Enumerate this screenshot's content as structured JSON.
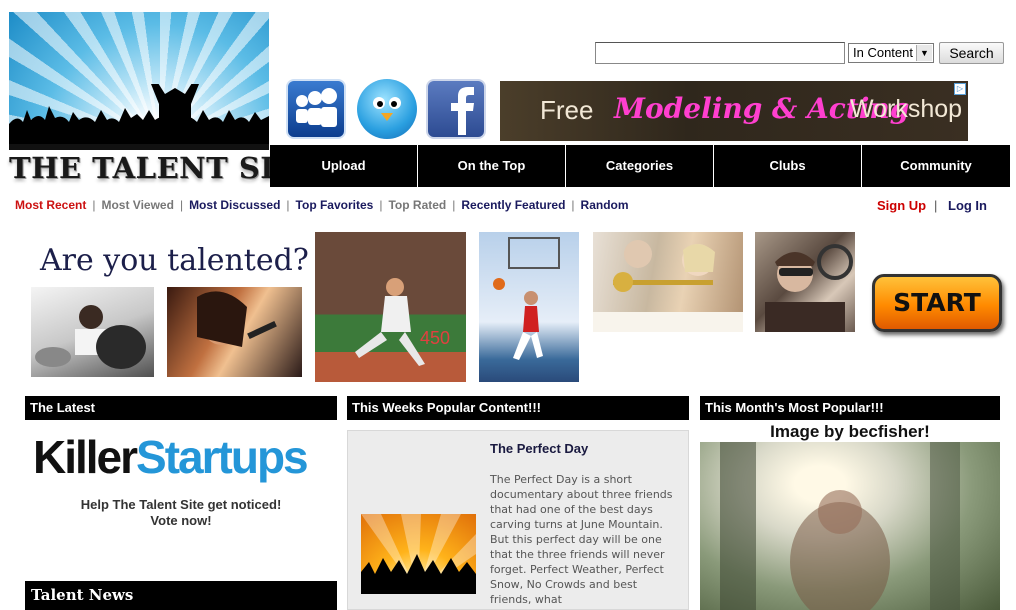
{
  "site": {
    "name": "THE TALENT SITE"
  },
  "search": {
    "placeholder": "",
    "scope": "In Content",
    "button": "Search"
  },
  "social": [
    {
      "icon": "myspace-icon"
    },
    {
      "icon": "twitter-icon"
    },
    {
      "icon": "facebook-icon"
    }
  ],
  "ad": {
    "free": "Free",
    "main": "Modeling & Acting",
    "tail": "Workshop",
    "badge": "▷"
  },
  "nav": [
    "Upload",
    "On the Top",
    "Categories",
    "Clubs",
    "Community"
  ],
  "subnav": [
    "Most Recent",
    "Most Viewed",
    "Most Discussed",
    "Top Favorites",
    "Top Rated",
    "Recently Featured",
    "Random"
  ],
  "auth": {
    "signup": "Sign Up",
    "separator": "|",
    "login": "Log In"
  },
  "promo": {
    "tagline": "Are you talented?",
    "start": "START"
  },
  "latest": {
    "heading": "The Latest",
    "logo_a": "Killer",
    "logo_b": "Startups",
    "line1": "Help The Talent Site get noticed!",
    "line2": "Vote now!"
  },
  "news": {
    "heading": "Talent News"
  },
  "weekly": {
    "heading": "This Weeks Popular Content!!!",
    "title": "The Perfect Day",
    "description": "The Perfect Day is a short documentary about three friends that had one of the best days carving turns at June Mountain. But this perfect day will be one that the three friends will never forget. Perfect Weather, Perfect Snow, No Crowds and best friends, what"
  },
  "monthly": {
    "heading": "This Month's Most Popular!!!",
    "caption": "Image by becfisher!"
  },
  "colors": {
    "nav_bg": "#000000",
    "active_red": "#cc1111",
    "link_navy": "#1a1a5e",
    "accent_blue": "#2496d8"
  }
}
